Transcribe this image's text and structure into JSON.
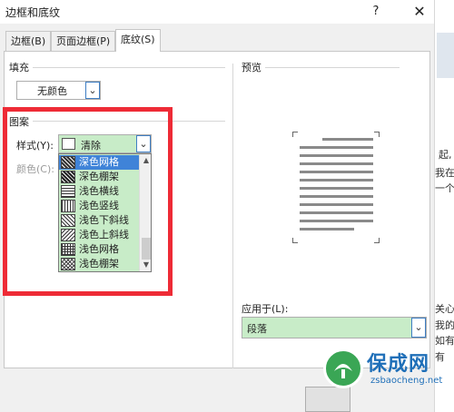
{
  "dialog": {
    "title": "边框和底纹",
    "help": "?",
    "close": "✕"
  },
  "tabs": [
    {
      "label": "边框(B)"
    },
    {
      "label": "页面边框(P)"
    },
    {
      "label": "底纹(S)"
    }
  ],
  "fill": {
    "label": "填充",
    "value": "无颜色"
  },
  "pattern": {
    "label": "图案",
    "style_label": "样式(Y):",
    "style_value": "清除",
    "color_label": "颜色(C):",
    "options": [
      "深色网格",
      "深色棚架",
      "浅色横线",
      "浅色竖线",
      "浅色下斜线",
      "浅色上斜线",
      "浅色网格",
      "浅色棚架"
    ]
  },
  "preview": {
    "label": "预览"
  },
  "apply_to": {
    "label": "应用于(L):",
    "value": "段落"
  },
  "background_strip": [
    "起,",
    "我在",
    "一个",
    "关心",
    "我的",
    "如有",
    "有"
  ],
  "watermark": {
    "brand": "保成网",
    "url": "zsbaocheng.net"
  },
  "colors": {
    "highlight_green": "#c8ecc8",
    "selection_blue": "#3f83d8",
    "annotation_red": "#ee2b36",
    "watermark_green": "#3aa655",
    "watermark_blue": "#1f6fb8"
  }
}
